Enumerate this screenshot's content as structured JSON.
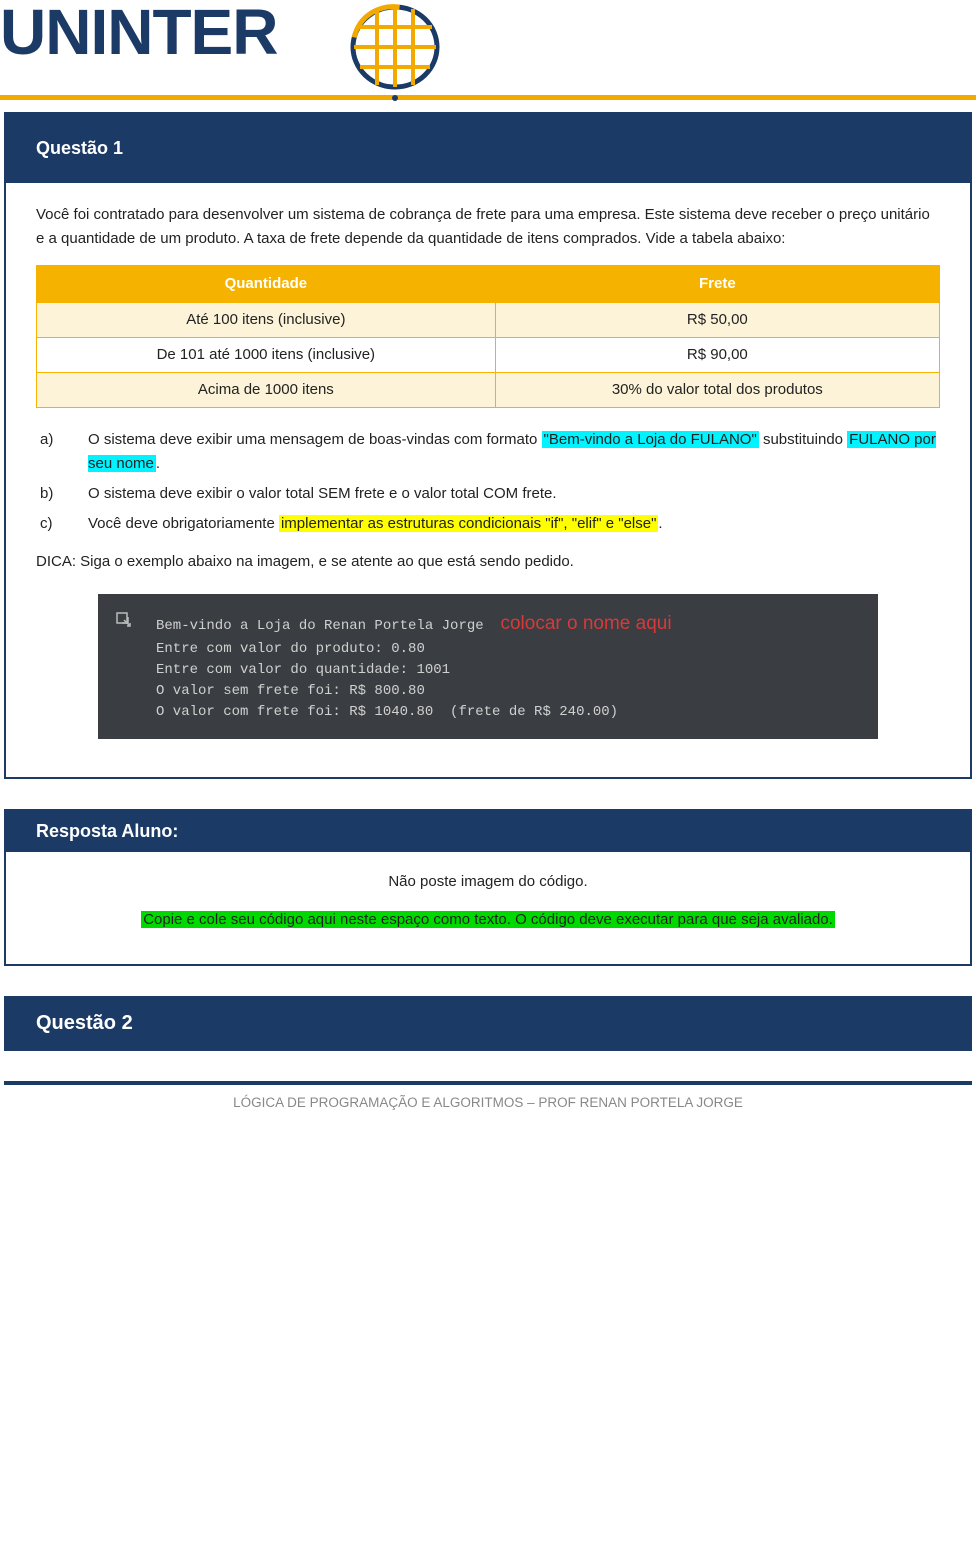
{
  "header": {
    "brand": "UNINTER"
  },
  "q1": {
    "title": "Questão 1",
    "intro1": "Você foi contratado para desenvolver um sistema de cobrança de frete para uma empresa. Este sistema deve receber o preço unitário e a quantidade de um produto. A taxa de frete depende da quantidade de itens comprados. Vide a tabela abaixo:",
    "table_header_col1": "Quantidade",
    "table_header_col2": "Frete",
    "rows": [
      {
        "qty": "Até 100 itens (inclusive)",
        "frete": "R$ 50,00"
      },
      {
        "qty": "De 101 até 1000 itens (inclusive)",
        "frete": "R$ 90,00"
      },
      {
        "qty": "Acima de 1000 itens",
        "frete": "30% do valor total dos produtos"
      }
    ],
    "items": {
      "a_pre": "a)",
      "a_text_1": "O sistema deve exibir uma mensagem de boas-vindas com formato ",
      "a_hl_1": "\"Bem-vindo a Loja do FULANO\"",
      "a_mid": " substituindo ",
      "a_hl_2": "FULANO por seu nome",
      "a_end": ".",
      "b_pre": "b)",
      "b_text": "O sistema deve exibir o valor total SEM frete e o valor total COM frete.",
      "c_pre": "c)",
      "c_text_1": "Você deve obrigatoriamente ",
      "c_hl": "implementar as estruturas condicionais \"if\", \"elif\" e \"else\"",
      "c_end": "."
    },
    "dica": "DICA: Siga o exemplo abaixo na imagem, e se atente ao que está sendo pedido.",
    "console": {
      "line1_a": "Bem-vindo a Loja do Renan Portela Jorge",
      "line1_note": "colocar o nome aqui",
      "line2": "Entre com valor do produto: 0.80",
      "line3": "Entre com valor do quantidade: 1001",
      "line4": "O valor sem frete foi: R$ 800.80",
      "line5": "O valor com frete foi: R$ 1040.80  (frete de R$ 240.00)"
    }
  },
  "resp1": {
    "title": "Resposta Aluno:",
    "line1": "Não poste imagem do código.",
    "hl": "Copie e cole seu código aqui neste espaço como texto. O código deve executar para que seja avaliado."
  },
  "q2": {
    "title": "Questão 2"
  },
  "footer": "LÓGICA DE PROGRAMAÇÃO E ALGORITMOS – PROF RENAN PORTELA JORGE"
}
